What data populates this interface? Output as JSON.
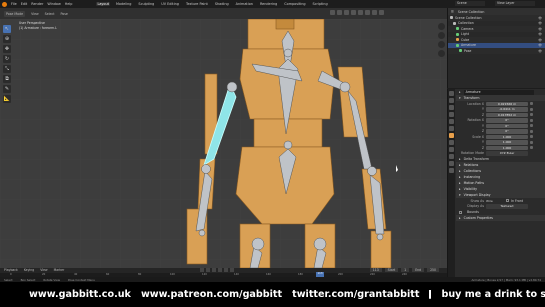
{
  "menubar": {
    "menus": [
      "File",
      "Edit",
      "Render",
      "Window",
      "Help"
    ],
    "workspaces": [
      "Layout",
      "Modeling",
      "Sculpting",
      "UV Editing",
      "Texture Paint",
      "Shading",
      "Animation",
      "Rendering",
      "Compositing",
      "Scripting"
    ],
    "active_workspace": "Layout",
    "scene": "Scene",
    "view_layer": "View Layer"
  },
  "viewport": {
    "header_items": [
      "Pose Mode",
      "View",
      "Select",
      "Pose"
    ],
    "info_line1": "User Perspective",
    "info_line2": "(1) Armature : forearm.L",
    "tools": [
      "select-icon",
      "cursor-icon",
      "move-icon",
      "rotate-icon",
      "scale-icon",
      "transform-icon",
      "annotate-icon",
      "measure-icon"
    ]
  },
  "timeline": {
    "menus": [
      "Playback",
      "Keying",
      "View",
      "Marker"
    ],
    "current_frame": "113",
    "start_label": "Start",
    "start": "1",
    "end_label": "End",
    "end": "250",
    "ruler": [
      "0",
      "20",
      "40",
      "60",
      "80",
      "100",
      "120",
      "140",
      "160",
      "180",
      "200",
      "220",
      "240"
    ]
  },
  "statusbar": {
    "items": [
      "Select",
      "Box Select",
      "Rotate View",
      "Pose Context Menu"
    ],
    "version": "Armature | Bones 2/17 | Mem: 93.1 MB | v2.80.74"
  },
  "outliner": {
    "title": "Scene Collection",
    "rows": [
      {
        "label": "Scene Collection",
        "color": "#bbbbbb",
        "selected": false
      },
      {
        "label": "Collection",
        "color": "#bbbbbb",
        "selected": false
      },
      {
        "label": "Camera",
        "color": "#66cc77",
        "selected": false
      },
      {
        "label": "Light",
        "color": "#66cc77",
        "selected": false
      },
      {
        "label": "Cube",
        "color": "#e8a04b",
        "selected": false
      },
      {
        "label": "Armature",
        "color": "#66cc77",
        "selected": true
      },
      {
        "label": "Pose",
        "color": "#66cc77",
        "selected": false
      }
    ]
  },
  "properties": {
    "object_name": "Armature",
    "sections": {
      "transform": "Transform",
      "delta": "Delta Transform",
      "relations": "Relations",
      "collections": "Collections",
      "instancing": "Instancing",
      "motion_paths": "Motion Paths",
      "visibility": "Visibility",
      "viewport_display": "Viewport Display",
      "custom_props": "Custom Properties"
    },
    "location": {
      "label": "Location X",
      "x": "0.021566 m",
      "y_label": "Y",
      "y": "-0.6411 m",
      "z_label": "Z",
      "z": "0.017852 m"
    },
    "rotation": {
      "label": "Rotation X",
      "x": "0°",
      "y_label": "Y",
      "y": "0°",
      "z_label": "Z",
      "z": "0°"
    },
    "scale": {
      "label": "Scale X",
      "x": "1.000",
      "y_label": "Y",
      "y": "1.000",
      "z_label": "Z",
      "z": "1.000"
    },
    "rotation_mode": {
      "label": "Rotation Mode",
      "value": "XYZ Euler"
    },
    "display": {
      "show_label": "Show As",
      "show_value": "Wire",
      "name_label": "Name",
      "axes_label": "In Front",
      "display_as_label": "Display As",
      "display_as_value": "Textured",
      "bounds_label": "Bounds"
    }
  },
  "banner": {
    "site1": "www.gabbitt.co.uk",
    "site2": "www.patreon.com/gabbitt",
    "site3": "twitter.com/grantabbitt",
    "message": "buy me a drink to say thanks - Paypal link in description"
  },
  "colors": {
    "bone_fill": "#bfc3c8",
    "mesh_wood": "#d9a055",
    "selected_bone": "#8fe5e8",
    "accent_blue": "#4772b3",
    "viewport_bg": "#3d3d3d"
  }
}
